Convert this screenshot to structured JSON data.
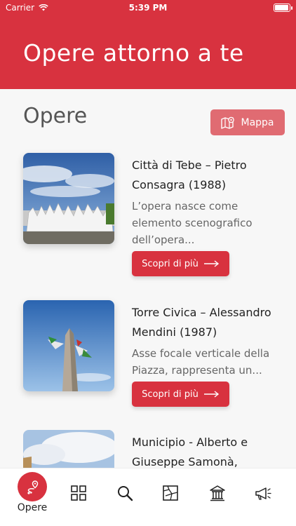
{
  "status_bar": {
    "carrier": "Carrier",
    "time": "5:39 PM"
  },
  "header": {
    "title": "Opere attorno a te"
  },
  "section": {
    "title": "Opere",
    "map_button_label": "Mappa"
  },
  "items": [
    {
      "title": "Città di Tebe – Pietro Consagra (1988)",
      "description_lines": [
        "L’opera nasce come",
        "elemento scenografico",
        "dell’opera..."
      ],
      "button_label": "Scopri di più"
    },
    {
      "title": "Torre Civica – Alessandro Mendini (1987)",
      "description_lines": [
        "Asse focale verticale della",
        "Piazza, rappresenta un..."
      ],
      "button_label": "Scopri di più"
    },
    {
      "title": "Municipio - Alberto e Giuseppe Samonà,",
      "description_lines": [],
      "button_label": ""
    }
  ],
  "tabbar": {
    "active_label": "Opere",
    "tabs": [
      "pin-route-icon",
      "grid-icon",
      "search-icon",
      "map-icon",
      "museum-icon",
      "megaphone-icon"
    ]
  },
  "colors": {
    "brand": "#d8323f",
    "map_button": "#e06b72"
  }
}
